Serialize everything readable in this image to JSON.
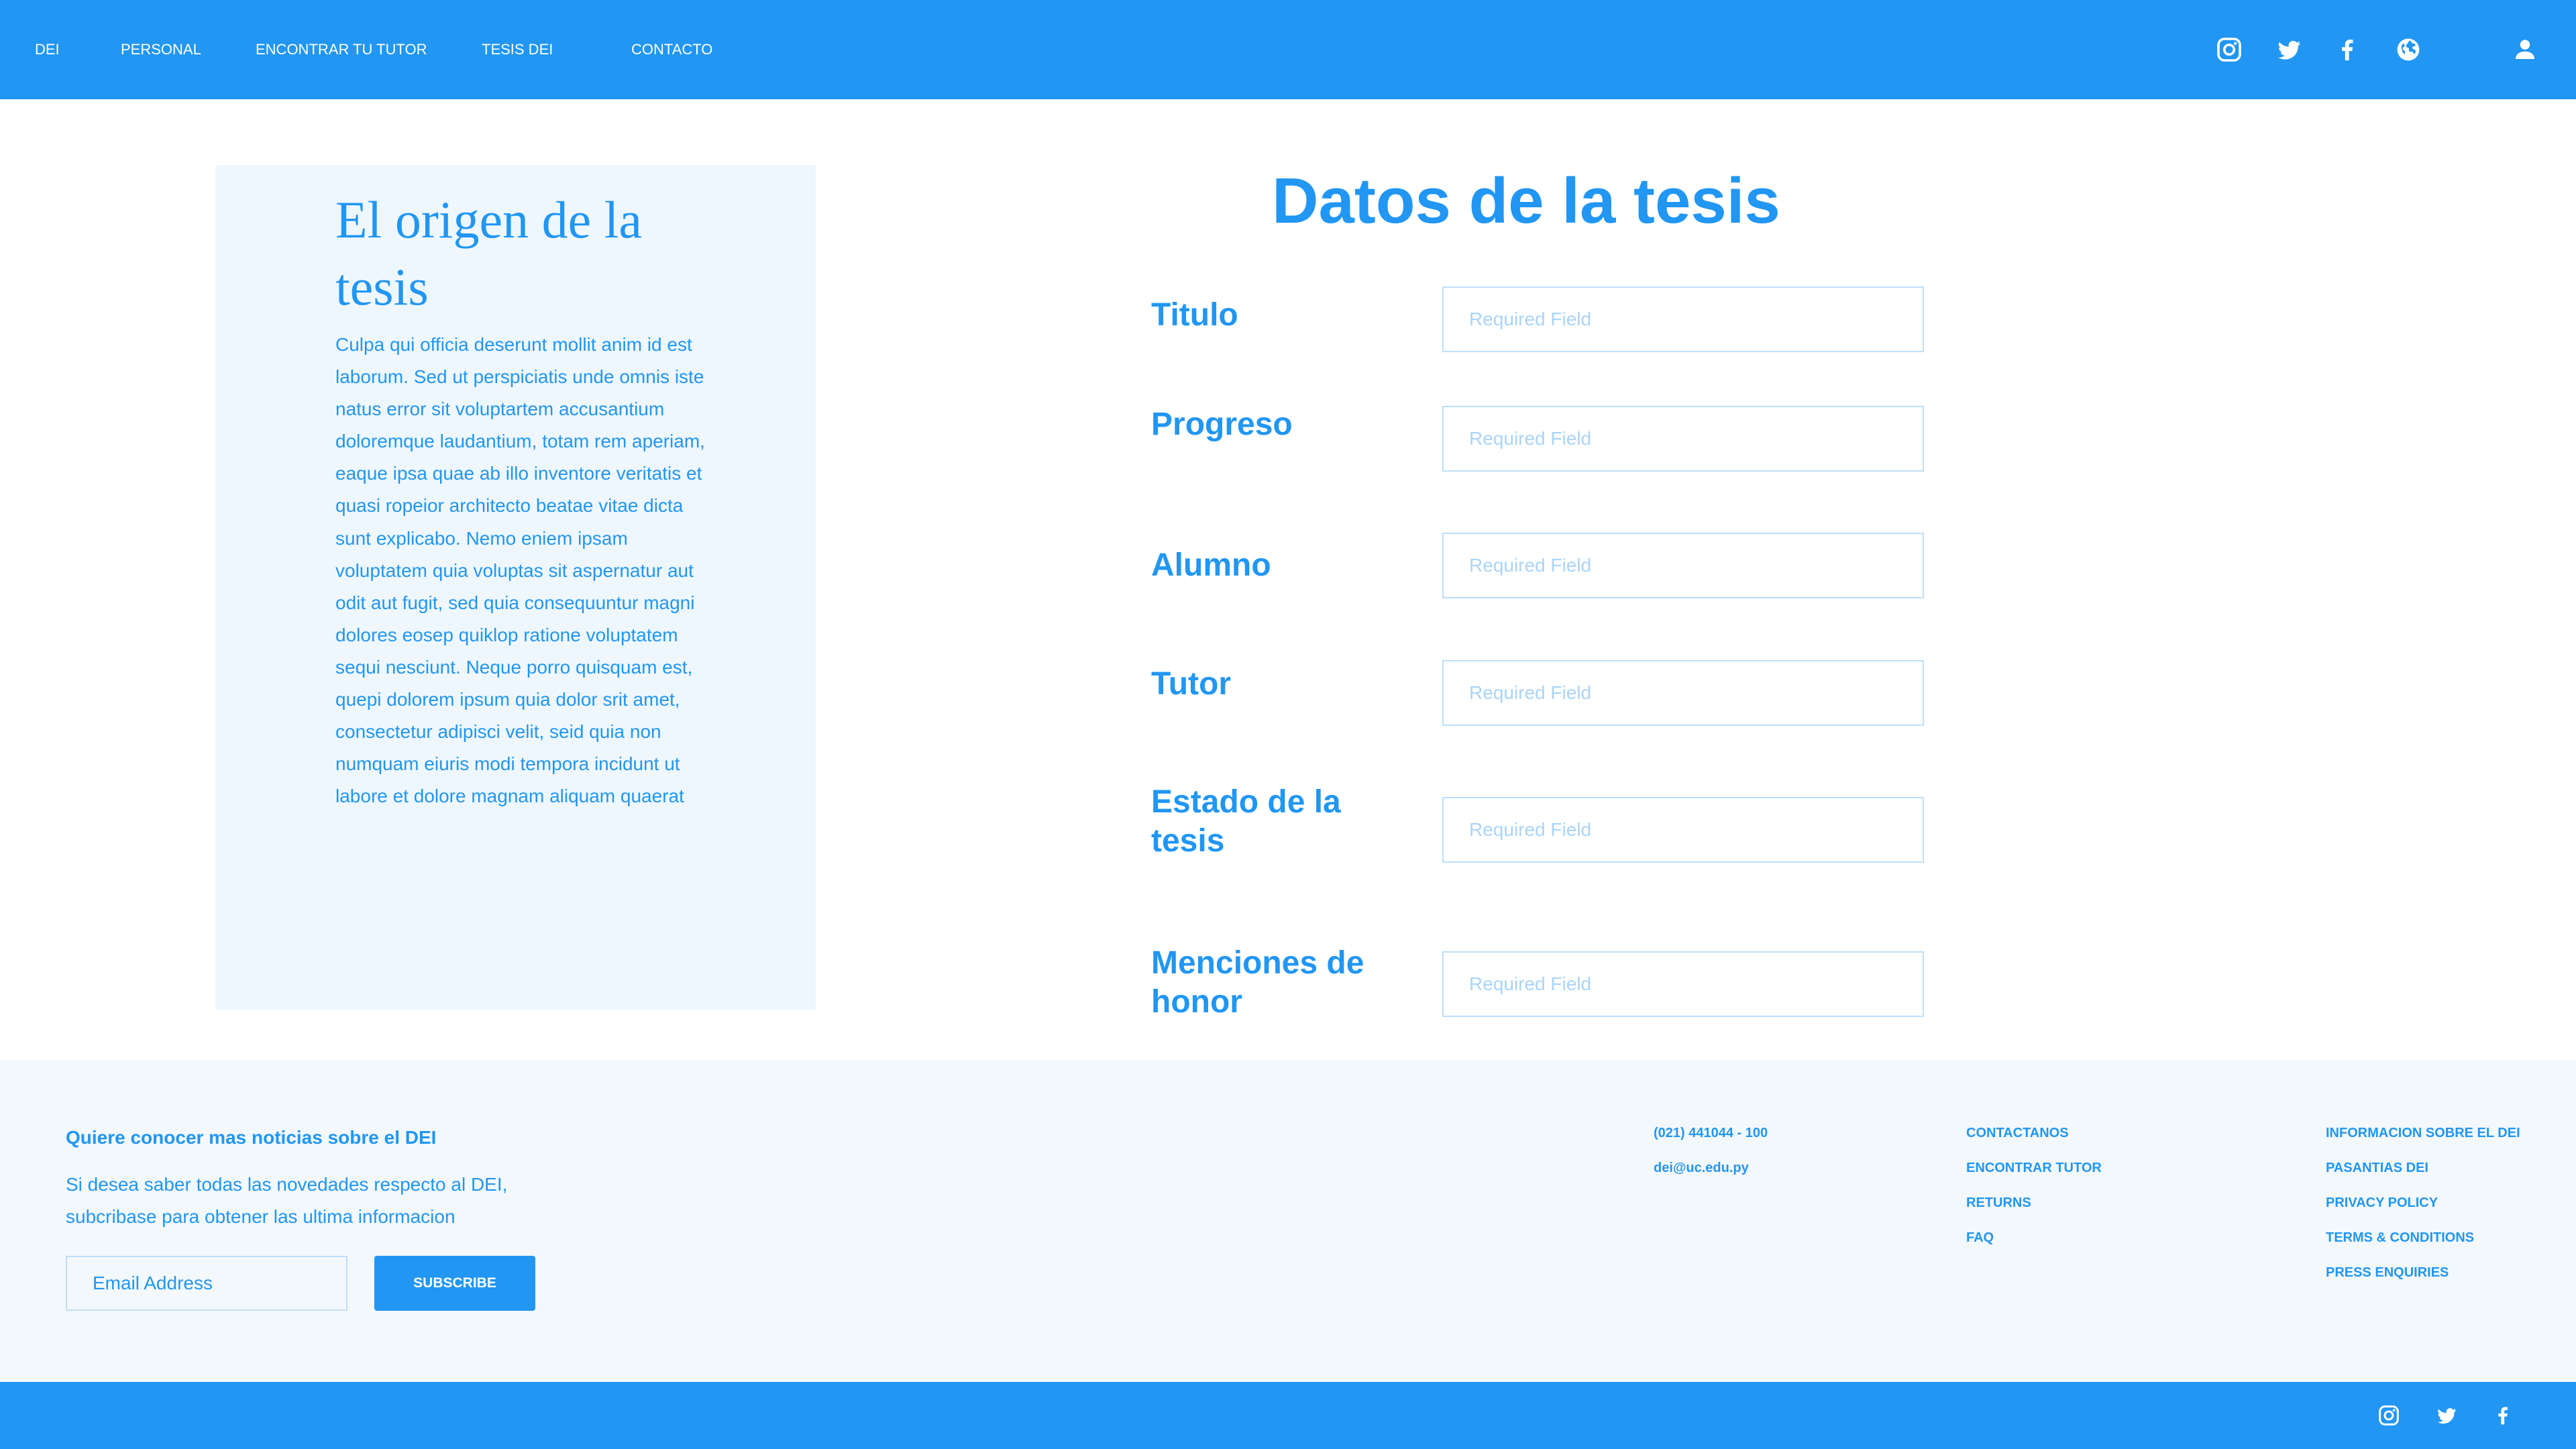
{
  "header": {
    "nav": [
      {
        "label": "DEI"
      },
      {
        "label": "PERSONAL"
      },
      {
        "label": "ENCONTRAR TU TUTOR"
      },
      {
        "label": "TESIS DEI"
      },
      {
        "label": "CONTACTO"
      }
    ],
    "icons": [
      "instagram-icon",
      "twitter-icon",
      "facebook-icon",
      "globe-icon",
      "user-icon"
    ]
  },
  "panel": {
    "title": "El origen de la tesis",
    "body": "Culpa qui officia deserunt mollit anim id est laborum. Sed ut perspiciatis unde omnis iste natus error sit voluptartem accusantium doloremque laudantium, totam rem aperiam, eaque ipsa quae ab illo inventore veritatis et quasi ropeior architecto beatae vitae dicta sunt explicabo. Nemo eniem ipsam voluptatem quia voluptas sit aspernatur aut odit aut fugit, sed quia consequuntur magni dolores eosep quiklop ratione voluptatem sequi nesciunt. Neque porro quisquam est, quepi dolorem ipsum quia dolor srit amet, consectetur adipisci velit, seid quia non numquam eiuris modi tempora incidunt ut labore et dolore magnam aliquam quaerat"
  },
  "form": {
    "title": "Datos de la tesis",
    "fields": [
      {
        "label": "Titulo",
        "placeholder": "Required Field",
        "value": ""
      },
      {
        "label": "Progreso",
        "placeholder": "Required Field",
        "value": ""
      },
      {
        "label": "Alumno",
        "placeholder": "Required Field",
        "value": ""
      },
      {
        "label": "Tutor",
        "placeholder": "Required Field",
        "value": ""
      },
      {
        "label": "Estado de la tesis",
        "placeholder": "Required Field",
        "value": ""
      },
      {
        "label": "Menciones de honor",
        "placeholder": "Required Field",
        "value": ""
      }
    ]
  },
  "footer": {
    "heading": "Quiere conocer mas noticias sobre el DEI",
    "description": "Si desea saber todas las novedades respecto al DEI, subcribase para obtener las ultima informacion",
    "email_placeholder": "Email Address",
    "subscribe_label": "SUBSCRIBE",
    "contact": [
      "(021) 441044 - 100",
      "dei@uc.edu.py"
    ],
    "links_col2": [
      "CONTACTANOS",
      "ENCONTRAR TUTOR",
      "RETURNS",
      "FAQ"
    ],
    "links_col3": [
      "INFORMACION SOBRE EL DEI",
      "PASANTIAS DEI",
      "PRIVACY POLICY",
      "TERMS & CONDITIONS",
      "PRESS ENQUIRIES"
    ]
  },
  "bottom_bar": {
    "icons": [
      "instagram-icon",
      "twitter-icon",
      "facebook-icon"
    ]
  },
  "colors": {
    "primary": "#2196f3",
    "panel_bg": "#eff7fe",
    "footer_bg": "#f3f8fc",
    "input_border": "#bcdffb",
    "placeholder": "#a9d4f8"
  }
}
